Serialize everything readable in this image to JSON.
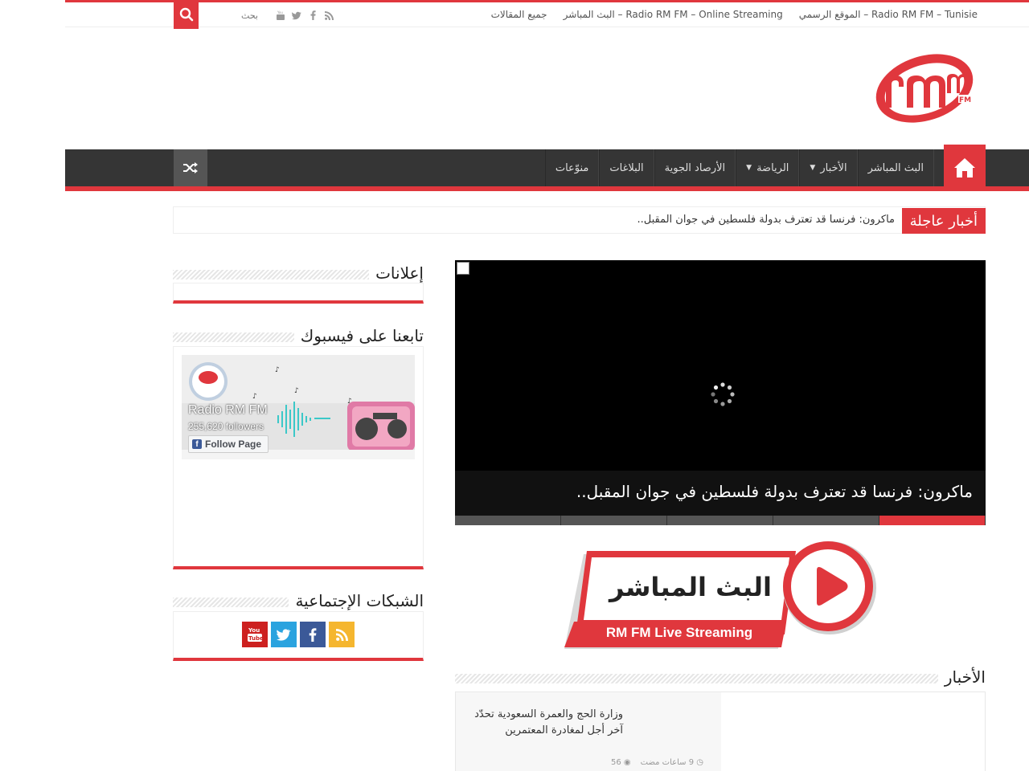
{
  "topbar": {
    "links": [
      "Radio RM FM – Tunisie – الموقع الرسمي",
      "Radio RM FM – Online Streaming – البث المباشر",
      "جميع المقالات"
    ],
    "search_placeholder": "بحث",
    "social_icons": [
      "youtube-icon",
      "twitter-icon",
      "facebook-icon",
      "rss-icon"
    ]
  },
  "nav": {
    "items": [
      {
        "label": "البث المباشر",
        "has_dropdown": false
      },
      {
        "label": "الأخبار",
        "has_dropdown": true
      },
      {
        "label": "الرياضة",
        "has_dropdown": true
      },
      {
        "label": "الأرصاد الجوية",
        "has_dropdown": false
      },
      {
        "label": "البلاغات",
        "has_dropdown": false
      },
      {
        "label": "منوّعات",
        "has_dropdown": false
      }
    ]
  },
  "breaking": {
    "label": "أخبار عاجلة",
    "text": "ماكرون: فرنسا قد تعترف بدولة فلسطين في جوان المقبل.."
  },
  "slider": {
    "caption": "ماكرون: فرنسا قد تعترف بدولة فلسطين في جوان المقبل..",
    "tab_count": 5,
    "active_tab": 5
  },
  "live_banner": {
    "title": "البث المباشر",
    "subtitle": "RM FM Live Streaming"
  },
  "news": {
    "section_title": "الأخبار",
    "items": [
      {
        "title": "وزارة الحج والعمرة السعودية تحدّد آخر أجل لمغادرة المعتمرين",
        "time": "9 ساعات مضت",
        "views": "56"
      }
    ]
  },
  "sidebar": {
    "ads_title": "إعلانات",
    "facebook_title": "تابعنا على فيسبوك",
    "fb_page_name": "Radio RM FM",
    "fb_followers": "255,620 followers",
    "fb_follow_label": "Follow Page",
    "social_title": "الشبكات الإجتماعية",
    "social_buttons": [
      {
        "icon": "rss-icon",
        "color": "#f5b62f"
      },
      {
        "icon": "facebook-icon",
        "color": "#3b5998"
      },
      {
        "icon": "twitter-icon",
        "color": "#2aa3df"
      },
      {
        "icon": "youtube-icon",
        "color": "#cd201f"
      }
    ]
  },
  "colors": {
    "accent": "#e0373d",
    "nav_bg": "#353535"
  }
}
